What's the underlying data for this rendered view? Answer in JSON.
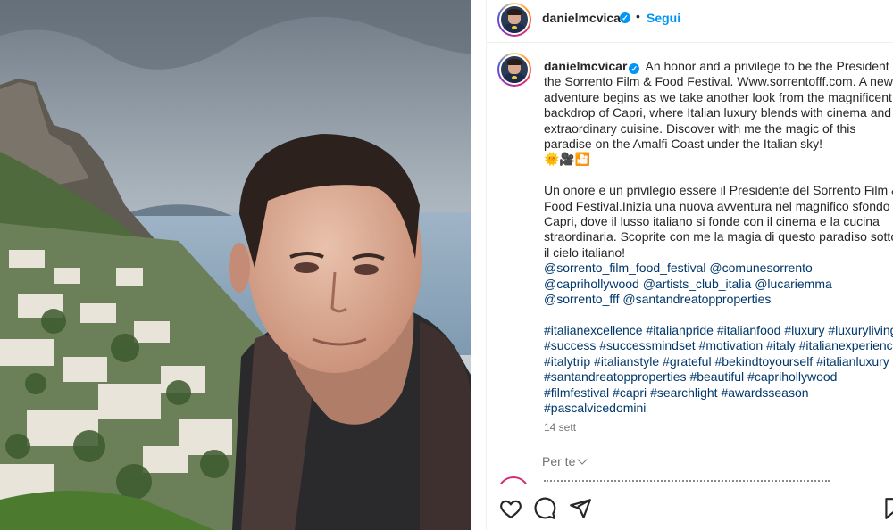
{
  "post": {
    "username": "danielmcvicar",
    "verified_mark": "✓",
    "separator": "•",
    "follow_label": "Segui"
  },
  "caption": {
    "username": "danielmcvicar",
    "en_lines": [
      " An honor and a privilege to be the President of",
      "the Sorrento Film & Food Festival. Www.sorrentofff.com. A new",
      "adventure begins as we take another look from the magnificent",
      "backdrop of Capri, where Italian luxury blends with cinema and",
      "extraordinary cuisine. Discover with me the magic of this",
      "paradise on the Amalfi Coast under the Italian sky!"
    ],
    "emoji": "🌞🎥🎦",
    "it_lines": [
      "Un onore e un privilegio essere il Presidente del Sorrento Film &",
      "Food Festival.Inizia una nuova avventura nel magnifico sfondo di",
      "Capri, dove il lusso italiano si fonde con il cinema e la cucina",
      "straordinaria. Scoprite con me la magia di questo paradiso sotto",
      "il cielo italiano!"
    ],
    "mentions": [
      [
        "@sorrento_film_food_festival",
        "@comunesorrento"
      ],
      [
        "@caprihollywood",
        "@artists_club_italia",
        "@lucariemma"
      ],
      [
        "@sorrento_fff",
        "@santandreatopproperties"
      ]
    ],
    "hashtags": [
      [
        "#italianexcellence",
        "#italianpride",
        "#italianfood",
        "#luxury",
        "#luxuryliving"
      ],
      [
        "#success",
        "#successmindset",
        "#motivation",
        "#italy",
        "#italianexperience"
      ],
      [
        "#italytrip",
        "#italianstyle",
        "#grateful",
        "#bekindtoyourself",
        "#italianluxury"
      ],
      [
        "#santandreatopproperties",
        "#beautiful",
        "#caprihollywood"
      ],
      [
        "#filmfestival",
        "#capri",
        "#searchlight",
        "#awardsseason"
      ],
      [
        "#pascalvicedomini"
      ]
    ],
    "date": "14 sett"
  },
  "more_label": "Per te",
  "actions": [
    "heart-icon",
    "comment-icon",
    "share-icon",
    "bookmark-icon"
  ]
}
